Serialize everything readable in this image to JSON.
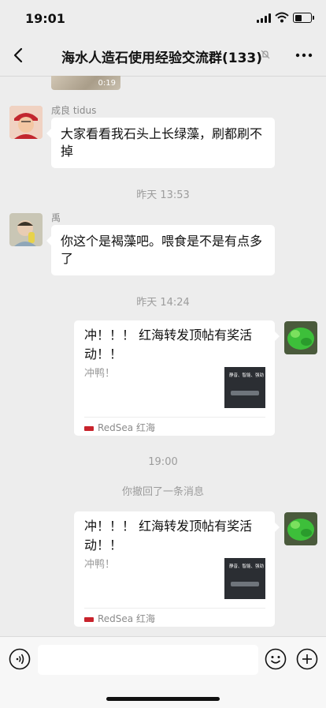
{
  "status_bar": {
    "time": "19:01"
  },
  "nav": {
    "title": "海水人造石使用经验交流群(133)"
  },
  "chat": {
    "video_duration": "0:19",
    "messages": [
      {
        "sender": "成良  tidus",
        "text": "大家看看我石头上长绿藻，刷都刷不掉"
      },
      {
        "time": "昨天 13:53"
      },
      {
        "sender": "禹",
        "text": "你这个是褐藻吧。喂食是不是有点多了"
      },
      {
        "time": "昨天 14:24"
      },
      {
        "card_title": "冲！！！ 红海转发顶帖有奖活动！！",
        "card_desc": "冲鸭！",
        "card_source": "RedSea 红海",
        "thumb_text": "静音、智能、强劲"
      },
      {
        "time": "19:00"
      },
      {
        "system": "你撤回了一条消息"
      },
      {
        "card_title": "冲！！！ 红海转发顶帖有奖活动！！",
        "card_desc": "冲鸭！",
        "card_source": "RedSea 红海",
        "thumb_text": "静音、智能、强劲"
      }
    ]
  },
  "colors": {
    "background": "#ededed",
    "bubble": "#ffffff",
    "brand_red": "#c8232c"
  }
}
